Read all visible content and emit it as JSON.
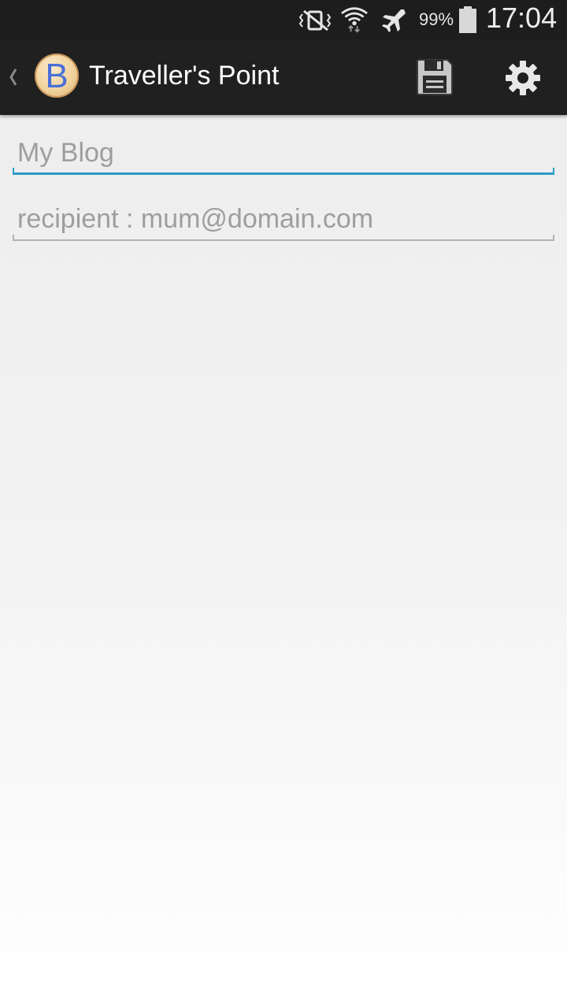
{
  "status_bar": {
    "icons": [
      "vibrate-mute-icon",
      "wifi-icon",
      "airplane-icon",
      "battery-icon"
    ],
    "battery_percent": "99%",
    "time": "17:04"
  },
  "action_bar": {
    "app_icon_letter": "B",
    "title": "Traveller's Point",
    "save_icon": "save-floppy-icon",
    "settings_icon": "gear-icon"
  },
  "form": {
    "blog_title": {
      "value": "",
      "placeholder": "My Blog"
    },
    "recipient": {
      "value": "",
      "placeholder": "recipient : mum@domain.com"
    }
  },
  "colors": {
    "status_bar_bg": "#1d1d1d",
    "action_bar_bg": "#202020",
    "focus_accent": "#2a9dc7",
    "placeholder_text": "#9e9e9e",
    "logo_letter": "#4a6fd8"
  }
}
